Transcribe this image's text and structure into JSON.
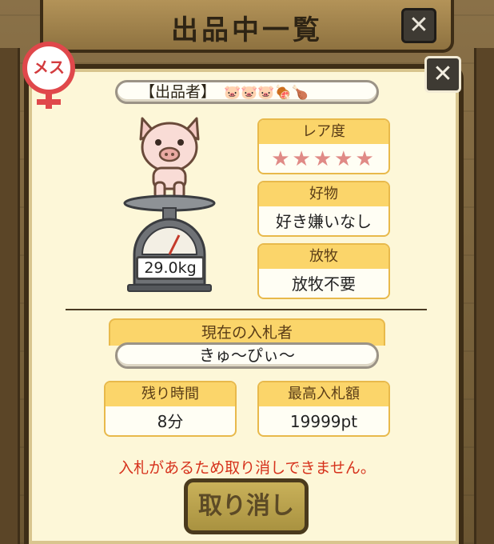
{
  "header": {
    "title": "出品中一覧"
  },
  "gender": {
    "label": "メス"
  },
  "seller": {
    "label": "【出品者】",
    "icons": "🐷🐷🐷🍖🍗"
  },
  "pig": {
    "weight": "29.0kg"
  },
  "rarity": {
    "label": "レア度",
    "stars": "★★★★★"
  },
  "favorite": {
    "label": "好物",
    "value": "好き嫌いなし"
  },
  "grazing": {
    "label": "放牧",
    "value": "放牧不要"
  },
  "bidder": {
    "label": "現在の入札者",
    "name": "きゅ〜ぴぃ〜"
  },
  "remaining": {
    "label": "残り時間",
    "value": "8分"
  },
  "highest_bid": {
    "label": "最高入札額",
    "value": "19999pt"
  },
  "notice": "入札があるため取り消しできません。",
  "cancel_button": "取り消し",
  "colors": {
    "accent": "#fbd56a",
    "notice": "#d6321c",
    "frame": "#3d2d16"
  }
}
